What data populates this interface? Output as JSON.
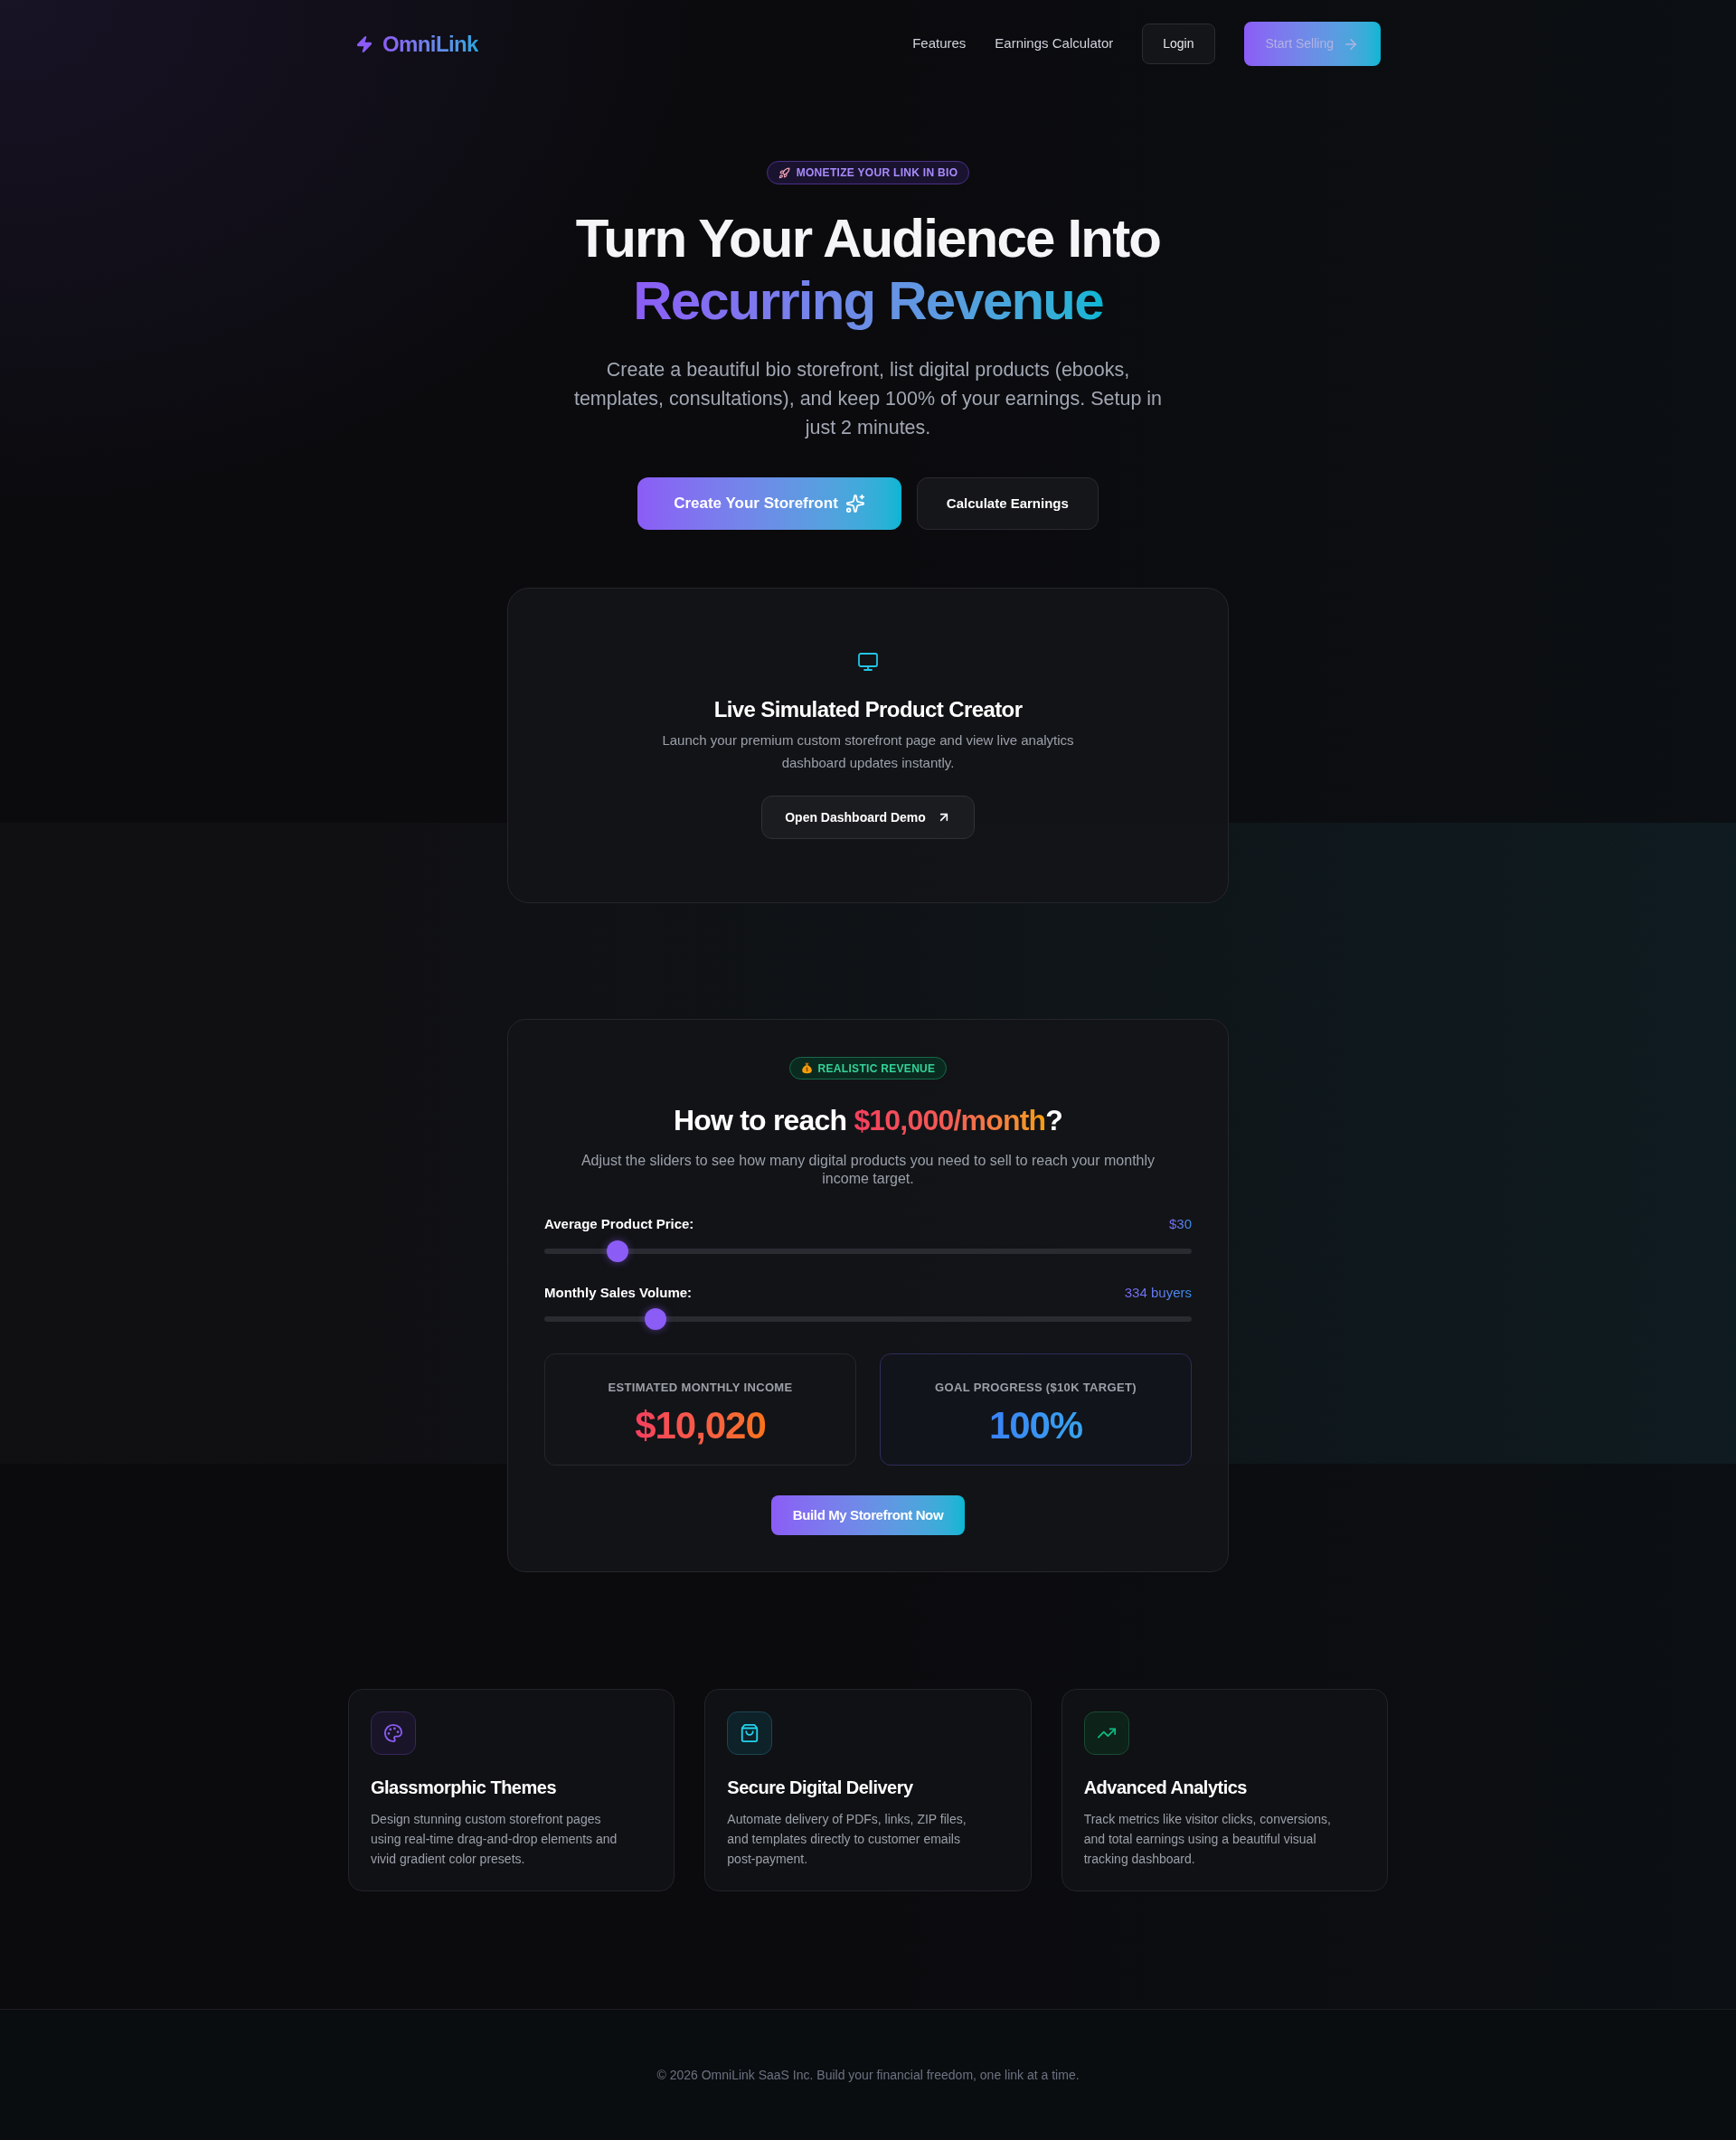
{
  "nav": {
    "logo": "OmniLink",
    "links": [
      "Features",
      "Earnings Calculator"
    ],
    "login": "Login",
    "cta": "Start Selling"
  },
  "hero": {
    "badge": "MONETIZE YOUR LINK IN BIO",
    "title": "Turn Your Audience Into",
    "title_highlight": "Recurring Revenue",
    "description": "Create a beautiful bio storefront, list digital products (ebooks, templates, consultations), and keep 100% of your earnings. Setup in just 2 minutes.",
    "buttons": [
      {
        "label": "Create Your Storefront",
        "kind": "primary"
      },
      {
        "label": "Calculate Earnings",
        "kind": "secondary"
      }
    ]
  },
  "demo": {
    "title": "Live Simulated Product Creator",
    "description": "Launch your premium custom storefront page and view live analytics dashboard updates instantly.",
    "button": "Open Dashboard Demo"
  },
  "calculator": {
    "badge": "REALISTIC REVENUE",
    "heading": {
      "text": "How to reach",
      "highlight": "$10,000/month",
      "suffix": "?"
    },
    "description": "Adjust the sliders to see how many digital products you need to sell to reach your monthly income target.",
    "sliders": [
      {
        "label": "Average Product Price:",
        "reading": "$30",
        "level": 0.1
      },
      {
        "label": "Monthly Sales Volume:",
        "reading": "334 buyers",
        "level": 0.16
      }
    ],
    "stats": [
      {
        "label": "ESTIMATED MONTHLY INCOME",
        "value": "$10,020",
        "kind": "income"
      },
      {
        "label": "GOAL PROGRESS ($10K TARGET)",
        "value": "100%",
        "kind": "progress"
      }
    ],
    "button": "Build My Storefront Now"
  },
  "features": [
    {
      "kind": "themes",
      "title": "Glassmorphic Themes",
      "description": "Design stunning custom storefront pages using real-time drag-and-drop elements and vivid gradient color presets."
    },
    {
      "kind": "delivery",
      "title": "Secure Digital Delivery",
      "description": "Automate delivery of PDFs, links, ZIP files, and templates directly to customer emails post-payment."
    },
    {
      "kind": "analytics",
      "title": "Advanced Analytics",
      "description": "Track metrics like visitor clicks, conversions, and total earnings using a beautiful visual tracking dashboard."
    }
  ],
  "footer": "© 2026 OmniLink SaaS Inc. Build your financial freedom, one link at a time."
}
